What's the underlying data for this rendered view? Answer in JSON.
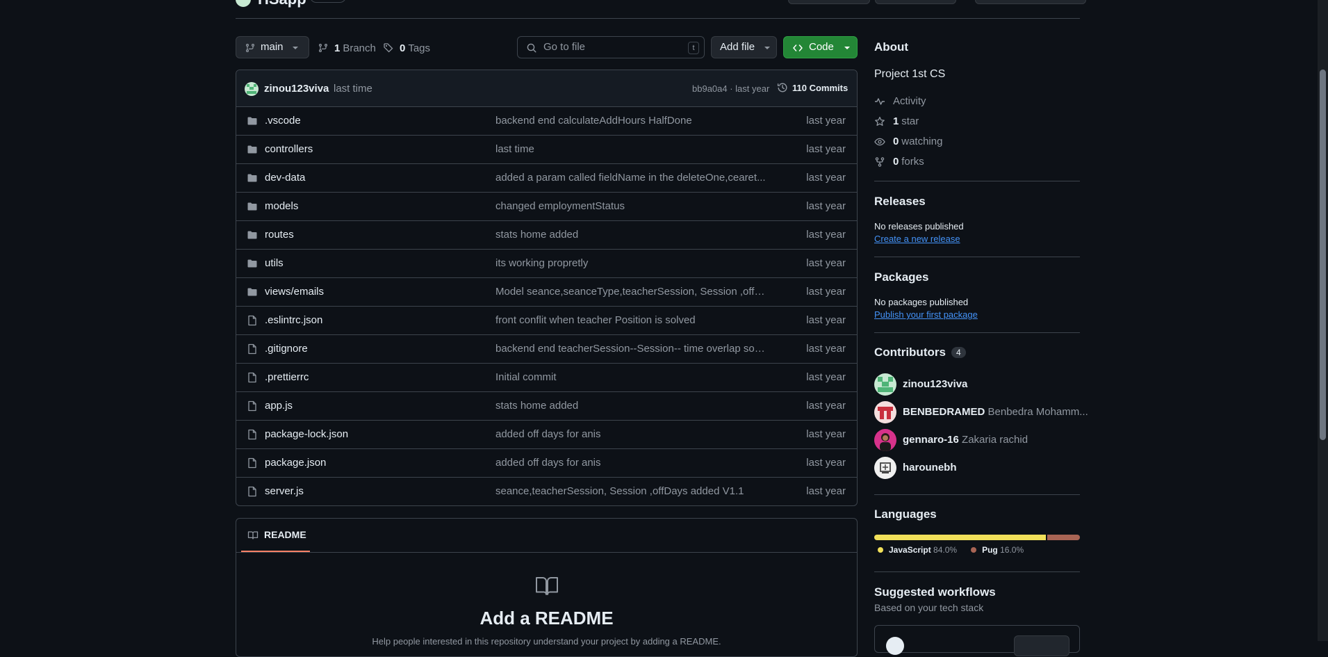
{
  "repo": {
    "name": "HSapp"
  },
  "toolbar": {
    "branch": "main",
    "branch_count": "1",
    "branch_label": "Branch",
    "tag_count": "0",
    "tag_label": "Tags",
    "search_placeholder": "Go to file",
    "search_shortcut": "t",
    "add_file": "Add file",
    "code": "Code"
  },
  "commit_bar": {
    "author": "zinou123viva",
    "message": "last time",
    "hash_time": "bb9a0a4 · last year",
    "commits": "110 Commits"
  },
  "files": [
    {
      "type": "folder",
      "name": ".vscode",
      "message": "backend end calculateAddHours HalfDone",
      "time": "last year"
    },
    {
      "type": "folder",
      "name": "controllers",
      "message": "last time",
      "time": "last year"
    },
    {
      "type": "folder",
      "name": "dev-data",
      "message": "added a param called fieldName in the deleteOne,cearet...",
      "time": "last year"
    },
    {
      "type": "folder",
      "name": "models",
      "message": "changed employmentStatus",
      "time": "last year"
    },
    {
      "type": "folder",
      "name": "routes",
      "message": "stats home added",
      "time": "last year"
    },
    {
      "type": "folder",
      "name": "utils",
      "message": "its working propretly",
      "time": "last year"
    },
    {
      "type": "folder",
      "name": "views/emails",
      "message": "Model seance,seanceType,teacherSession, Session ,offD...",
      "time": "last year"
    },
    {
      "type": "file",
      "name": ".eslintrc.json",
      "message": "front conflit when teacher Position is solved",
      "time": "last year"
    },
    {
      "type": "file",
      "name": ".gitignore",
      "message": "backend end teacherSession--Session-- time overlap solv...",
      "time": "last year"
    },
    {
      "type": "file",
      "name": ".prettierrc",
      "message": "Initial commit",
      "time": "last year"
    },
    {
      "type": "file",
      "name": "app.js",
      "message": "stats home added",
      "time": "last year"
    },
    {
      "type": "file",
      "name": "package-lock.json",
      "message": "added off days for anis",
      "time": "last year"
    },
    {
      "type": "file",
      "name": "package.json",
      "message": "added off days for anis",
      "time": "last year"
    },
    {
      "type": "file",
      "name": "server.js",
      "message": "seance,teacherSession, Session ,offDays added V1.1",
      "time": "last year"
    }
  ],
  "readme": {
    "tab": "README",
    "title": "Add a README",
    "subtitle": "Help people interested in this repository understand your project by adding a README."
  },
  "about": {
    "heading": "About",
    "description": "Project 1st CS",
    "activity": "Activity",
    "stars_count": "1",
    "stars_label": "star",
    "watching_count": "0",
    "watching_label": "watching",
    "forks_count": "0",
    "forks_label": "forks"
  },
  "releases": {
    "heading": "Releases",
    "none": "No releases published",
    "link": "Create a new release"
  },
  "packages": {
    "heading": "Packages",
    "none": "No packages published",
    "link": "Publish your first package"
  },
  "contributors": {
    "heading": "Contributors",
    "count": "4",
    "list": [
      {
        "login": "zinou123viva",
        "name": ""
      },
      {
        "login": "BENBEDRAMED",
        "name": "Benbedra Mohamm..."
      },
      {
        "login": "gennaro-16",
        "name": "Zakaria rachid"
      },
      {
        "login": "harounebh",
        "name": ""
      }
    ]
  },
  "languages": {
    "heading": "Languages",
    "items": [
      {
        "name": "JavaScript",
        "percent": "84.0%",
        "value": 84.0,
        "color": "#f1e05a"
      },
      {
        "name": "Pug",
        "percent": "16.0%",
        "value": 16.0,
        "color": "#a86454"
      }
    ]
  },
  "workflows": {
    "heading": "Suggested workflows",
    "sub": "Based on your tech stack"
  }
}
